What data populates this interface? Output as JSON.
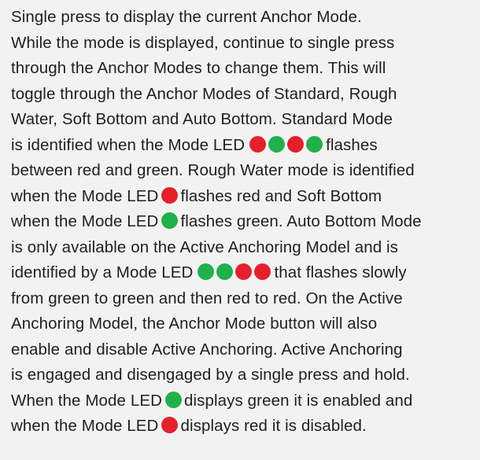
{
  "lines": [
    "Single press to display the current Anchor Mode.",
    "While the mode is displayed, continue to single press",
    "through the Anchor Modes to change them. This will",
    "toggle through the Anchor Modes of Standard, Rough",
    "Water, Soft Bottom and Auto Bottom. Standard Mode",
    [
      "is identified when the Mode LED",
      "flashes"
    ],
    "between red and green. Rough Water mode is identified",
    [
      "when the Mode LED",
      "flashes red and Soft Bottom"
    ],
    [
      "when the Mode LED",
      "flashes green. Auto Bottom Mode"
    ],
    "is only available on the Active Anchoring Model and is",
    [
      "identified by a Mode LED",
      "that flashes slowly"
    ],
    "from green to green and then red to red. On the Active",
    "Anchoring Model, the Anchor Mode button will also",
    "enable and disable Active Anchoring. Active Anchoring",
    "is engaged and disengaged by a single press and hold.",
    [
      "When the Mode LED",
      "displays green it is enabled and"
    ],
    [
      "when the Mode LED",
      "displays red it is disabled."
    ]
  ],
  "leds": {
    "standard_mode": [
      "red",
      "green",
      "red",
      "green"
    ],
    "rough_water": [
      "red"
    ],
    "soft_bottom": [
      "green"
    ],
    "auto_bottom": [
      "green",
      "green",
      "red",
      "red"
    ],
    "enabled": [
      "green"
    ],
    "disabled": [
      "red"
    ]
  },
  "colors": {
    "red": "#e4202c",
    "green": "#21b04b",
    "text": "#1f1f1f",
    "background": "#f2f2f2"
  }
}
